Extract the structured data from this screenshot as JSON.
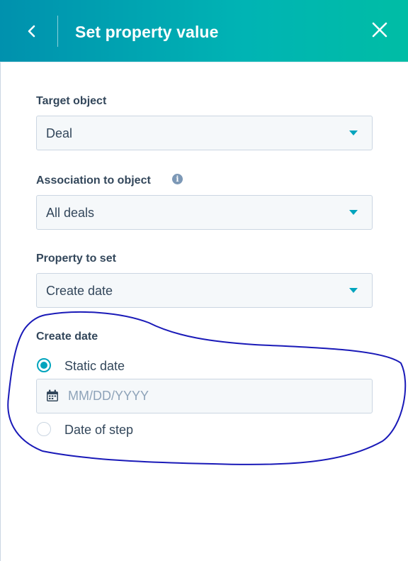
{
  "header": {
    "title": "Set property value",
    "back_icon": "chevron-left-icon",
    "close_icon": "close-icon"
  },
  "fields": {
    "target_object": {
      "label": "Target object",
      "value": "Deal"
    },
    "association": {
      "label": "Association to object",
      "value": "All deals",
      "info_icon": "info-icon"
    },
    "property_to_set": {
      "label": "Property to set",
      "value": "Create date"
    }
  },
  "create_date": {
    "label": "Create date",
    "options": [
      {
        "label": "Static date",
        "selected": true
      },
      {
        "label": "Date of step",
        "selected": false
      }
    ],
    "date_input": {
      "placeholder": "MM/DD/YYYY",
      "value": "",
      "icon": "calendar-icon"
    }
  },
  "colors": {
    "header_start": "#0091ae",
    "header_end": "#00bda5",
    "accent": "#00a4bd",
    "text": "#33475b",
    "field_bg": "#f5f8fa",
    "field_border": "#cbd6e2",
    "annotation": "#1a1ab8"
  }
}
